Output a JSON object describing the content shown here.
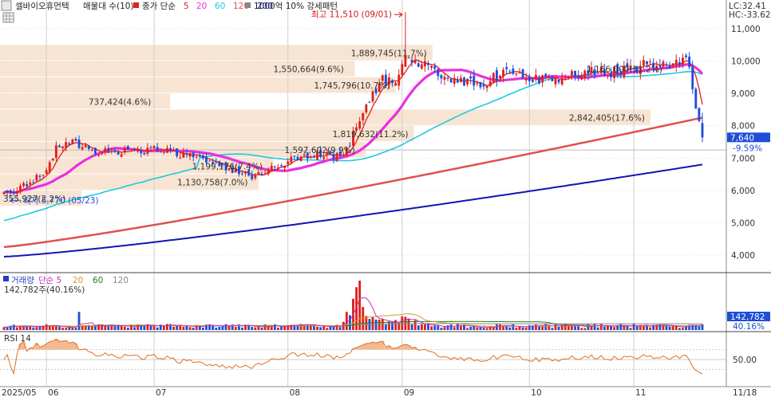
{
  "header": {
    "stock_name": "셀바이오휴먼텍",
    "panel": "매물대 수(10)",
    "price_ma_label": "종가 단순",
    "ma_periods": [
      "5",
      "20",
      "60",
      "120",
      "200"
    ],
    "ma_colors": [
      "#e0201c",
      "#e830e0",
      "#20c8e0",
      "#e05050",
      "#1414b4"
    ],
    "pattern_label": "1000억 10% 강세패턴",
    "lc": "LC:32.41",
    "hc": "HC:-33.62"
  },
  "chart_data": [
    {
      "type": "candlestick",
      "title": "셀바이오휴먼텍",
      "y_axis": {
        "ticks": [
          "11,000",
          "10,000",
          "9,000",
          "8,000",
          "7,000",
          "6,000",
          "5,000",
          "4,000"
        ],
        "tick_values": [
          11000,
          10000,
          9000,
          8000,
          7000,
          6000,
          5000,
          4000
        ],
        "range": [
          3500,
          11900
        ]
      },
      "x_axis": {
        "labels": [
          "2025/05",
          "06",
          "07",
          "08",
          "09",
          "10",
          "11",
          "11/18"
        ],
        "label_positions": [
          0,
          13,
          46,
          87,
          122,
          161,
          193,
          215
        ]
      },
      "n_days": 215,
      "current_price": {
        "value": 7640,
        "label": "7,640",
        "change": "-9.59%"
      },
      "annotations": {
        "high": {
          "text": "최고 11,510 (09/01)",
          "value": 11510,
          "day": 123
        },
        "low": {
          "text": "최저 5,770 (05/23)",
          "value": 5770,
          "day": 1
        }
      },
      "volume_profile": [
        {
          "label": "1,889,745(11.7%)",
          "price_low": 10000,
          "price_high": 10500,
          "pct": 11.7
        },
        {
          "label": "1,550,664(9.6%)",
          "price_low": 9500,
          "price_high": 10000,
          "pct": 9.6
        },
        {
          "label": "1,745,796(10.7%)",
          "price_low": 9000,
          "price_high": 9500,
          "pct": 10.7
        },
        {
          "label": "737,424(4.6%)",
          "price_low": 8500,
          "price_high": 9000,
          "pct": 4.6
        },
        {
          "label": "2,842,405(17.6%)",
          "price_low": 8000,
          "price_high": 8500,
          "pct": 17.6
        },
        {
          "label": "1,819,632(11.2%)",
          "price_low": 7500,
          "price_high": 8000,
          "pct": 11.2
        },
        {
          "label": "1,597,602(9.9%)",
          "price_low": 7000,
          "price_high": 7500,
          "pct": 9.9
        },
        {
          "label": "1,199,176(7.4%)",
          "price_low": 6500,
          "price_high": 7000,
          "pct": 7.4
        },
        {
          "label": "1,130,758(7.0%)",
          "price_low": 6000,
          "price_high": 6500,
          "pct": 7.0
        },
        {
          "label": "355,927(2.2%)",
          "price_low": 5500,
          "price_high": 6000,
          "pct": 2.2
        }
      ],
      "extra_label": "1,166,000(11.2%)"
    },
    {
      "type": "bar",
      "title": "거래량",
      "legend": [
        "거래량",
        "단순 5",
        "20",
        "60",
        "120"
      ],
      "legend_colors": [
        "#2040c0",
        "#c030c0",
        "#d0a020",
        "#208020",
        "#888888"
      ],
      "summary": "142,782주(40.16%)",
      "current": {
        "value": 142782,
        "label": "142,782",
        "pct": "40.16%"
      }
    },
    {
      "type": "line",
      "title": "RSI 14",
      "y_ticks": [
        "50.00"
      ],
      "y_tick_values": [
        50
      ],
      "range": [
        0,
        100
      ]
    }
  ]
}
